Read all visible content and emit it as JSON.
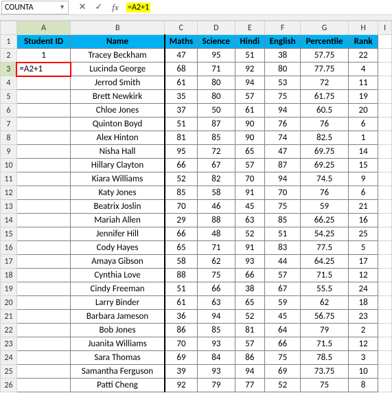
{
  "formula_bar": {
    "name_box": "COUNTA",
    "cancel": "✕",
    "confirm": "✓",
    "fx": "fx",
    "formula": "=A2+1"
  },
  "columns": [
    "A",
    "B",
    "C",
    "D",
    "E",
    "F",
    "G",
    "H",
    "I"
  ],
  "headers": {
    "A": "Student ID",
    "B": "Name",
    "C": "Maths",
    "D": "Science",
    "E": "Hindi",
    "F": "English",
    "G": "Percentile",
    "H": "Rank"
  },
  "active_cell": "=A2+1",
  "chart_data": {
    "type": "table",
    "columns": [
      "Student ID",
      "Name",
      "Maths",
      "Science",
      "Hindi",
      "English",
      "Percentile",
      "Rank"
    ],
    "rows": [
      [
        "1",
        "Tracey Beckham",
        "47",
        "95",
        "51",
        "38",
        "57.75",
        "22"
      ],
      [
        "=A2+1",
        "Lucinda George",
        "68",
        "71",
        "92",
        "80",
        "77.75",
        "4"
      ],
      [
        "",
        "Jerrod Smith",
        "61",
        "80",
        "94",
        "53",
        "72",
        "11"
      ],
      [
        "",
        "Brett Newkirk",
        "35",
        "80",
        "57",
        "75",
        "61.75",
        "19"
      ],
      [
        "",
        "Chloe Jones",
        "37",
        "50",
        "61",
        "94",
        "60.5",
        "20"
      ],
      [
        "",
        "Quinton Boyd",
        "51",
        "87",
        "90",
        "76",
        "76",
        "6"
      ],
      [
        "",
        "Alex Hinton",
        "81",
        "85",
        "90",
        "74",
        "82.5",
        "1"
      ],
      [
        "",
        "Nisha Hall",
        "95",
        "72",
        "65",
        "47",
        "69.75",
        "14"
      ],
      [
        "",
        "Hillary Clayton",
        "66",
        "67",
        "57",
        "87",
        "69.25",
        "15"
      ],
      [
        "",
        "Kiara Williams",
        "52",
        "82",
        "70",
        "94",
        "74.5",
        "9"
      ],
      [
        "",
        "Katy Jones",
        "85",
        "58",
        "91",
        "70",
        "76",
        "6"
      ],
      [
        "",
        "Beatrix Joslin",
        "70",
        "46",
        "45",
        "75",
        "59",
        "21"
      ],
      [
        "",
        "Mariah Allen",
        "29",
        "88",
        "63",
        "85",
        "66.25",
        "16"
      ],
      [
        "",
        "Jennifer Hill",
        "66",
        "48",
        "52",
        "51",
        "54.25",
        "25"
      ],
      [
        "",
        "Cody Hayes",
        "65",
        "71",
        "91",
        "83",
        "77.5",
        "5"
      ],
      [
        "",
        "Amaya Gibson",
        "58",
        "62",
        "93",
        "44",
        "64.25",
        "17"
      ],
      [
        "",
        "Cynthia Love",
        "88",
        "75",
        "66",
        "57",
        "71.5",
        "12"
      ],
      [
        "",
        "Cindy Freeman",
        "51",
        "66",
        "38",
        "67",
        "55.5",
        "24"
      ],
      [
        "",
        "Larry Binder",
        "61",
        "63",
        "65",
        "59",
        "62",
        "18"
      ],
      [
        "",
        "Barbara Jameson",
        "36",
        "94",
        "52",
        "45",
        "56.75",
        "23"
      ],
      [
        "",
        "Bob Jones",
        "86",
        "85",
        "81",
        "64",
        "79",
        "2"
      ],
      [
        "",
        "Juanita Williams",
        "70",
        "93",
        "57",
        "66",
        "71.5",
        "12"
      ],
      [
        "",
        "Sara Thomas",
        "69",
        "84",
        "86",
        "75",
        "78.5",
        "3"
      ],
      [
        "",
        "Samantha Ferguson",
        "39",
        "93",
        "94",
        "69",
        "73.75",
        "10"
      ],
      [
        "",
        "Patti Cheng",
        "92",
        "79",
        "77",
        "52",
        "75",
        "8"
      ]
    ]
  }
}
